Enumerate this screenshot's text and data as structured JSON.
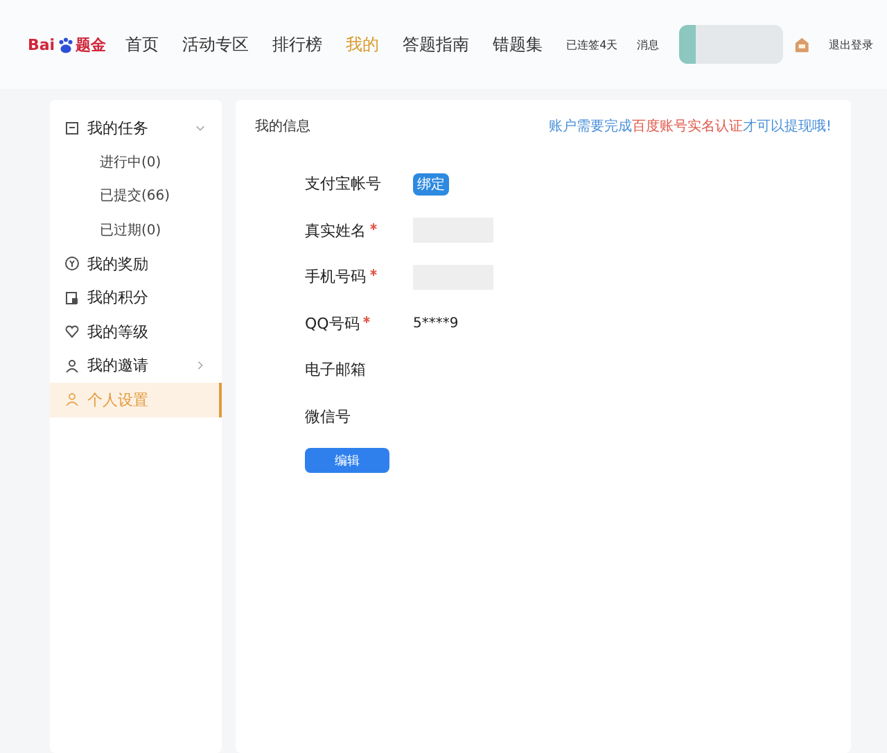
{
  "header": {
    "logo": {
      "latin": "Bai",
      "cn": "题金"
    },
    "nav": [
      {
        "label": "首页",
        "selected": false
      },
      {
        "label": "活动专区",
        "selected": false
      },
      {
        "label": "排行榜",
        "selected": false
      },
      {
        "label": "我的",
        "selected": true
      },
      {
        "label": "答题指南",
        "selected": false
      },
      {
        "label": "错题集",
        "selected": false
      }
    ],
    "streak": "已连签4天",
    "messages": "消息",
    "logout": "退出登录"
  },
  "sidebar": {
    "items": [
      {
        "label": "我的任务",
        "selected": false,
        "expanded": true,
        "children": [
          {
            "label": "进行中(0)"
          },
          {
            "label": "已提交(66)"
          },
          {
            "label": "已过期(0)"
          }
        ]
      },
      {
        "label": "我的奖励",
        "selected": false
      },
      {
        "label": "我的积分",
        "selected": false
      },
      {
        "label": "我的等级",
        "selected": false
      },
      {
        "label": "我的邀请",
        "selected": false,
        "expanded": false
      },
      {
        "label": "个人设置",
        "selected": true
      }
    ]
  },
  "main": {
    "title": "我的信息",
    "notice": [
      {
        "text": "账户需要完成",
        "kind": "plain"
      },
      {
        "text": "百度账号实名认证",
        "kind": "highlight"
      },
      {
        "text": "才可以提现哦!",
        "kind": "plain"
      }
    ],
    "fields": [
      {
        "label": "支付宝帐号",
        "required": false,
        "kind": "button",
        "value": "绑定"
      },
      {
        "label": "真实姓名",
        "required": true,
        "kind": "hidden"
      },
      {
        "label": "手机号码",
        "required": true,
        "kind": "hidden"
      },
      {
        "label": "QQ号码",
        "required": true,
        "kind": "text",
        "value": "5****9"
      },
      {
        "label": "电子邮箱",
        "required": false,
        "kind": "text"
      },
      {
        "label": "微信号",
        "required": false,
        "kind": "text"
      }
    ],
    "edit_button": "编辑"
  }
}
